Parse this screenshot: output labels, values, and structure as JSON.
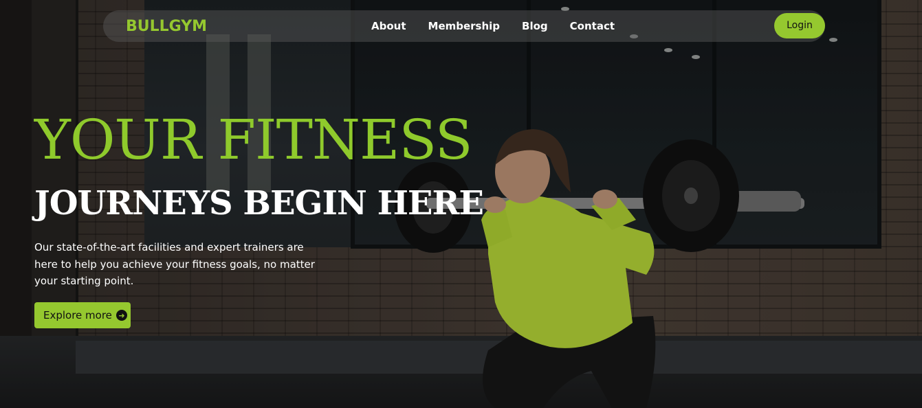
{
  "nav": {
    "brand": "BULLGYM",
    "links": [
      {
        "label": "About"
      },
      {
        "label": "Membership"
      },
      {
        "label": "Blog"
      },
      {
        "label": "Contact"
      }
    ],
    "login_label": "Login"
  },
  "hero": {
    "headline_primary": "YOUR FITNESS",
    "headline_secondary": "JOURNEYS BEGIN HERE",
    "description": "Our state-of-the-art facilities and expert trainers are here to help you achieve your fitness goals, no matter your starting point.",
    "cta_label": "Explore more",
    "cta_icon": "arrow-circle-right-icon",
    "background_image": "woman-barbell-squat-photo"
  },
  "colors": {
    "accent": "#95c82f",
    "text_light": "#ffffff",
    "nav_bg": "rgba(90,90,90,0.45)"
  }
}
